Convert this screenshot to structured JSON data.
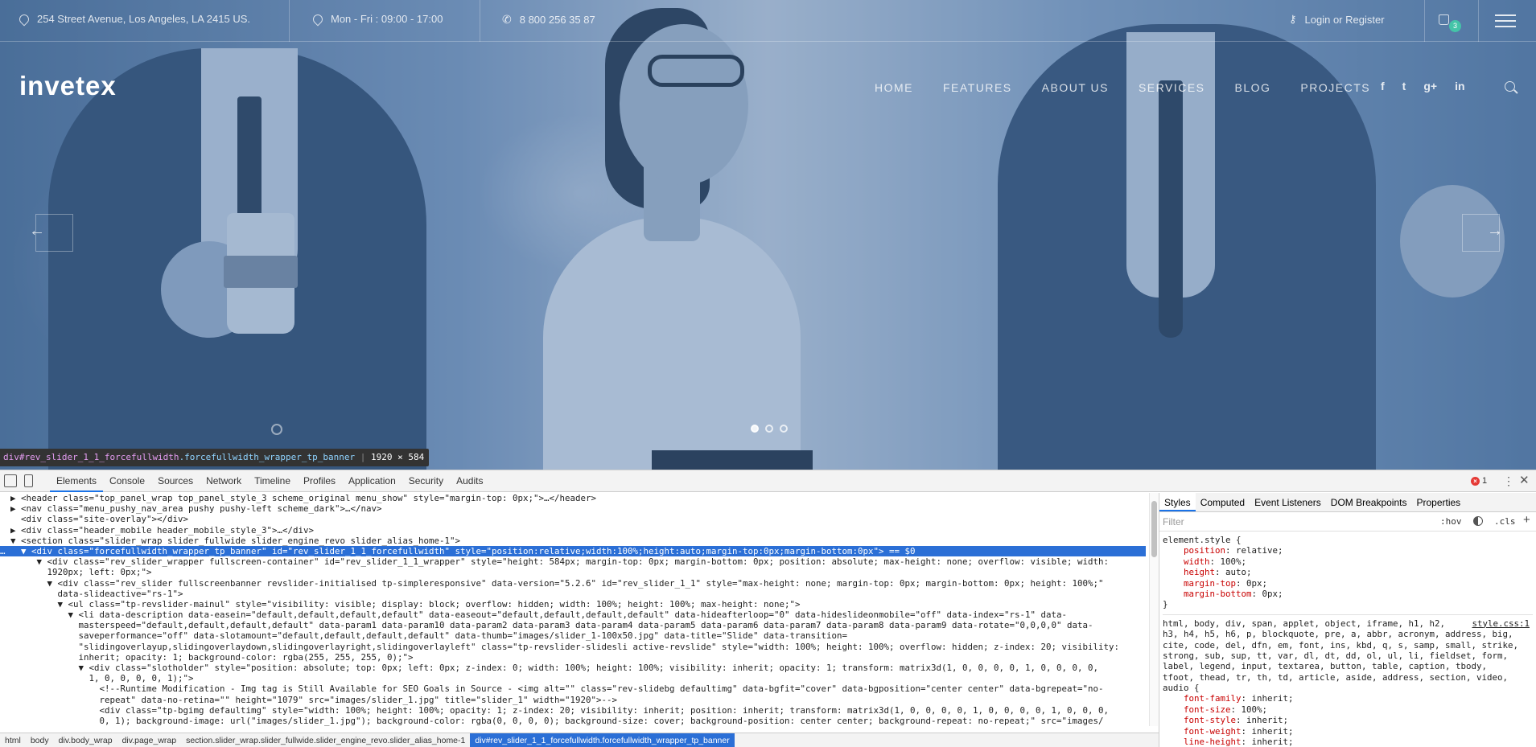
{
  "site": {
    "topbar": {
      "address": "254 Street Avenue, Los Angeles, LA 2415 US.",
      "hours": "Mon - Fri : 09:00 - 17:00",
      "phone": "8 800 256 35 87",
      "login": "Login or Register",
      "cart_count": "3"
    },
    "logo": "invetex",
    "nav": [
      "HOME",
      "FEATURES",
      "ABOUT US",
      "SERVICES",
      "BLOG",
      "PROJECTS"
    ],
    "social": [
      "f",
      "t",
      "g+",
      "in"
    ],
    "slider": {
      "prev_arrow": "←",
      "next_arrow": "→",
      "dots": 3,
      "active_dot": 1
    }
  },
  "element_tooltip": {
    "tag": "div",
    "id": "#rev_slider_1_1_forcefullwidth",
    "class": ".forcefullwidth_wrapper_tp_banner",
    "size": "1920 × 584"
  },
  "devtools": {
    "tabs": [
      "Elements",
      "Console",
      "Sources",
      "Network",
      "Timeline",
      "Profiles",
      "Application",
      "Security",
      "Audits"
    ],
    "active_tab": "Elements",
    "error_count": "1",
    "dom_lines": [
      "  ▶ <header class=\"top_panel_wrap top_panel_style_3 scheme_original menu_show\" style=\"margin-top: 0px;\">…</header>",
      "  ▶ <nav class=\"menu_pushy_nav_area pushy pushy-left scheme_dark\">…</nav>",
      "    <div class=\"site-overlay\"></div>",
      "  ▶ <div class=\"header_mobile header_mobile_style_3\">…</div>",
      "  ▼ <section class=\"slider_wrap slider_fullwide slider_engine_revo slider_alias_home-1\">",
      "…   ▼ <div class=\"forcefullwidth_wrapper_tp_banner\" id=\"rev_slider_1_1_forcefullwidth\" style=\"position:relative;width:100%;height:auto;margin-top:0px;margin-bottom:0px\"> == $0",
      "       ▼ <div class=\"rev_slider_wrapper fullscreen-container\" id=\"rev_slider_1_1_wrapper\" style=\"height: 584px; margin-top: 0px; margin-bottom: 0px; position: absolute; max-height: none; overflow: visible; width:",
      "         1920px; left: 0px;\">",
      "         ▼ <div class=\"rev_slider fullscreenbanner revslider-initialised tp-simpleresponsive\" data-version=\"5.2.6\" id=\"rev_slider_1_1\" style=\"max-height: none; margin-top: 0px; margin-bottom: 0px; height: 100%;\"",
      "           data-slideactive=\"rs-1\">",
      "           ▼ <ul class=\"tp-revslider-mainul\" style=\"visibility: visible; display: block; overflow: hidden; width: 100%; height: 100%; max-height: none;\">",
      "             ▼ <li data-description data-easein=\"default,default,default,default\" data-easeout=\"default,default,default,default\" data-hideafterloop=\"0\" data-hideslideonmobile=\"off\" data-index=\"rs-1\" data-",
      "               masterspeed=\"default,default,default,default\" data-param1 data-param10 data-param2 data-param3 data-param4 data-param5 data-param6 data-param7 data-param8 data-param9 data-rotate=\"0,0,0,0\" data-",
      "               saveperformance=\"off\" data-slotamount=\"default,default,default,default\" data-thumb=\"images/slider_1-100x50.jpg\" data-title=\"Slide\" data-transition=",
      "               \"slidingoverlayup,slidingoverlaydown,slidingoverlayright,slidingoverlayleft\" class=\"tp-revslider-slidesli active-revslide\" style=\"width: 100%; height: 100%; overflow: hidden; z-index: 20; visibility:",
      "               inherit; opacity: 1; background-color: rgba(255, 255, 255, 0);\">",
      "               ▼ <div class=\"slotholder\" style=\"position: absolute; top: 0px; left: 0px; z-index: 0; width: 100%; height: 100%; visibility: inherit; opacity: 1; transform: matrix3d(1, 0, 0, 0, 0, 1, 0, 0, 0, 0,",
      "                 1, 0, 0, 0, 0, 1);\">",
      "                   <!--Runtime Modification - Img tag is Still Available for SEO Goals in Source - <img alt=\"\" class=\"rev-slidebg defaultimg\" data-bgfit=\"cover\" data-bgposition=\"center center\" data-bgrepeat=\"no-",
      "                   repeat\" data-no-retina=\"\" height=\"1079\" src=\"images/slider_1.jpg\" title=\"slider_1\" width=\"1920\">-->",
      "                   <div class=\"tp-bgimg defaultimg\" style=\"width: 100%; height: 100%; opacity: 1; z-index: 20; visibility: inherit; position: inherit; transform: matrix3d(1, 0, 0, 0, 0, 1, 0, 0, 0, 0, 1, 0, 0, 0,",
      "                   0, 1); background-image: url(\"images/slider_1.jpg\"); background-color: rgba(0, 0, 0, 0); background-size: cover; background-position: center center; background-repeat: no-repeat;\" src=\"images/"
    ],
    "selected_line_index": 5,
    "breadcrumbs": [
      "html",
      "body",
      "div.body_wrap",
      "div.page_wrap",
      "section.slider_wrap.slider_fullwide.slider_engine_revo.slider_alias_home-1",
      "div#rev_slider_1_1_forcefullwidth.forcefullwidth_wrapper_tp_banner"
    ],
    "styles_tabs": [
      "Styles",
      "Computed",
      "Event Listeners",
      "DOM Breakpoints",
      "Properties"
    ],
    "filter_placeholder": "Filter",
    "hov_label": ":hov",
    "cls_label": ".cls",
    "element_style": {
      "selector": "element.style {",
      "props": [
        {
          "name": "position",
          "value": "relative;"
        },
        {
          "name": "width",
          "value": "100%;"
        },
        {
          "name": "height",
          "value": "auto;"
        },
        {
          "name": "margin-top",
          "value": "0px;"
        },
        {
          "name": "margin-bottom",
          "value": "0px;"
        }
      ]
    },
    "reset_rule": {
      "selector_lines": [
        "html, body, div, span, applet, object, iframe, h1, h2,",
        "h3, h4, h5, h6, p, blockquote, pre, a, abbr, acronym, address, big,",
        "cite, code, del, dfn, em, font, ins, kbd, q, s, samp, small, strike,",
        "strong, sub, sup, tt, var, dl, dt, dd, ol, ul, li, fieldset, form,",
        "label, legend, input, textarea, button, table, caption, tbody,",
        "tfoot, thead, tr, th, td, article, aside, address, section, video,",
        "audio {"
      ],
      "source": "style.css:1",
      "props": [
        {
          "name": "font-family",
          "value": "inherit;"
        },
        {
          "name": "font-size",
          "value": "100%;"
        },
        {
          "name": "font-style",
          "value": "inherit;"
        },
        {
          "name": "font-weight",
          "value": "inherit;"
        },
        {
          "name": "line-height",
          "value": "inherit;"
        }
      ]
    }
  }
}
